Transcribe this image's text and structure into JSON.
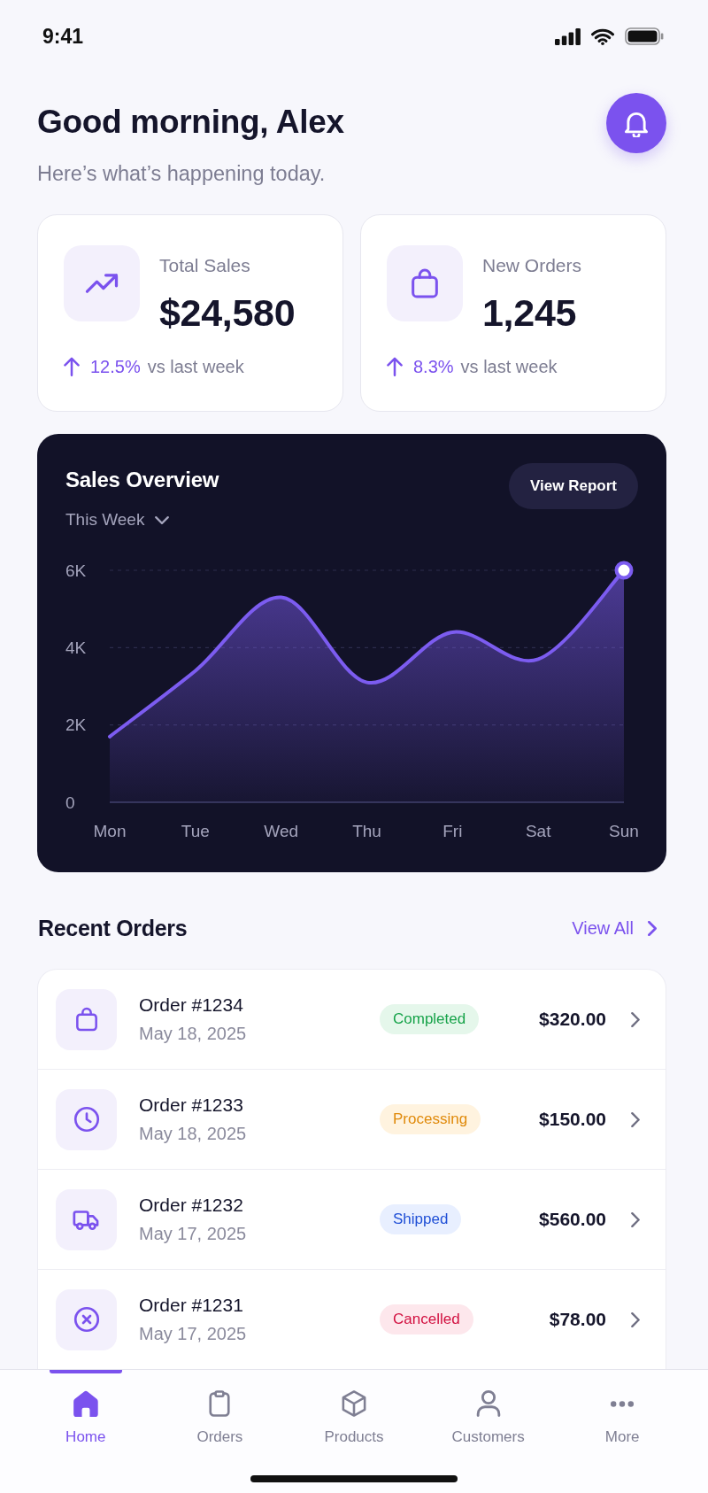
{
  "status_bar": {
    "time": "9:41"
  },
  "header": {
    "greeting": "Good morning, Alex",
    "subtitle": "Here’s what’s happening today."
  },
  "stats": [
    {
      "label": "Total Sales",
      "value": "$24,580",
      "increase": true,
      "change": "12.5%",
      "period": "vs last week"
    },
    {
      "label": "New Orders",
      "value": "1,245",
      "increase": true,
      "change": "8.3%",
      "period": "vs last week"
    }
  ],
  "sales_overview": {
    "period": "This Week",
    "button": "View Report",
    "chart_data": {
      "type": "area",
      "title": "Sales Overview",
      "categories": [
        "Mon",
        "Tue",
        "Wed",
        "Thu",
        "Fri",
        "Sat",
        "Sun"
      ],
      "series": [
        {
          "color": "#7c5cf0",
          "values": [
            1700,
            3400,
            5300,
            3100,
            4400,
            3700,
            6000
          ]
        }
      ],
      "ylim": [
        0,
        6000
      ],
      "yticks": [
        {
          "value": 0,
          "label": "0"
        },
        {
          "value": 2000,
          "label": "2K"
        },
        {
          "value": 4000,
          "label": "4K"
        },
        {
          "value": 6000,
          "label": "6K"
        }
      ]
    }
  },
  "recent_orders": {
    "title": "Recent Orders",
    "link": "View All",
    "rows": [
      {
        "kind": "completed",
        "order": "Order #1234",
        "date": "May 18, 2025",
        "status": "Completed",
        "amount": "$320.00"
      },
      {
        "kind": "processing",
        "order": "Order #1233",
        "date": "May 18, 2025",
        "status": "Processing",
        "amount": "$150.00"
      },
      {
        "kind": "shipped",
        "order": "Order #1232",
        "date": "May 17, 2025",
        "status": "Shipped",
        "amount": "$560.00"
      },
      {
        "kind": "cancelled",
        "order": "Order #1231",
        "date": "May 17, 2025",
        "status": "Cancelled",
        "amount": "$78.00"
      }
    ]
  },
  "nav": {
    "items": [
      {
        "label": "Home",
        "selected": true
      },
      {
        "label": "Orders",
        "selected": false
      },
      {
        "label": "Products",
        "selected": false
      },
      {
        "label": "Customers",
        "selected": false
      },
      {
        "label": "More",
        "selected": false
      }
    ]
  }
}
